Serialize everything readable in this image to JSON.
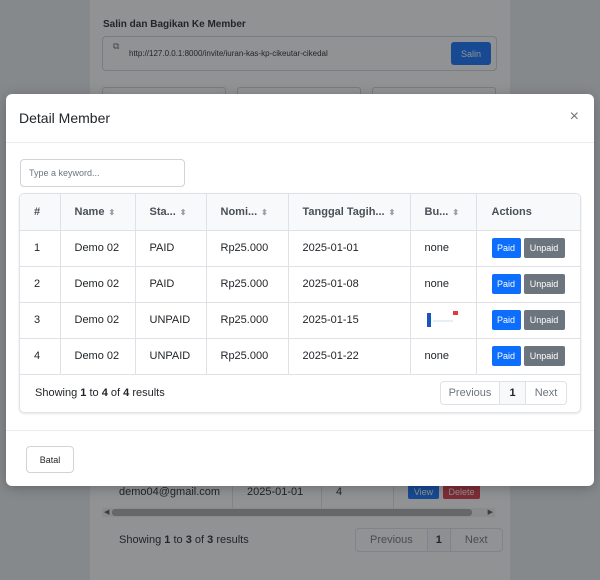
{
  "background": {
    "share_title": "Salin dan Bagikan Ke Member",
    "invite_url": "http://127.0.0.1:8000/invite/iuran-kas-kp-cikeutar-cikedal",
    "copy_label": "Salin",
    "member_row": {
      "email": "demo04@gmail.com",
      "date": "2025-01-01",
      "count": "4",
      "view_label": "View",
      "delete_label": "Delete"
    },
    "showing": {
      "prefix": "Showing",
      "from": "1",
      "to_word": "to",
      "to": "3",
      "of_word": "of",
      "total": "3",
      "suffix": "results"
    },
    "pager": {
      "prev": "Previous",
      "current": "1",
      "next": "Next"
    }
  },
  "modal": {
    "title": "Detail Member",
    "close_glyph": "×",
    "search_placeholder": "Type a keyword...",
    "columns": [
      "#",
      "Name",
      "Sta...",
      "Nomi...",
      "Tanggal Tagih...",
      "Bu...",
      "Actions"
    ],
    "rows": [
      {
        "no": "1",
        "name": "Demo 02",
        "status": "PAID",
        "nominal": "Rp25.000",
        "date": "2025-01-01",
        "bukti": "none"
      },
      {
        "no": "2",
        "name": "Demo 02",
        "status": "PAID",
        "nominal": "Rp25.000",
        "date": "2025-01-08",
        "bukti": "none"
      },
      {
        "no": "3",
        "name": "Demo 02",
        "status": "UNPAID",
        "nominal": "Rp25.000",
        "date": "2025-01-15",
        "bukti": ""
      },
      {
        "no": "4",
        "name": "Demo 02",
        "status": "UNPAID",
        "nominal": "Rp25.000",
        "date": "2025-01-22",
        "bukti": "none"
      }
    ],
    "action_paid": "Paid",
    "action_unpaid": "Unpaid",
    "showing": {
      "prefix": "Showing",
      "from": "1",
      "to_word": "to",
      "to": "4",
      "of_word": "of",
      "total": "4",
      "suffix": "results"
    },
    "pager": {
      "prev": "Previous",
      "current": "1",
      "next": "Next"
    },
    "cancel_label": "Batal"
  },
  "colors": {
    "primary": "#0d6efd",
    "secondary": "#6c757d",
    "danger": "#dc3545",
    "backdrop": "rgba(33,37,41,0.5)"
  }
}
